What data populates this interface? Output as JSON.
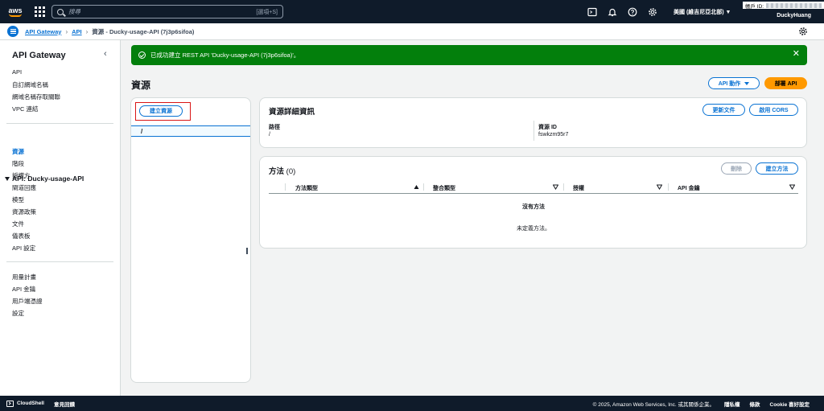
{
  "topnav": {
    "logo": "aws",
    "search_placeholder": "搜尋",
    "search_shortcut": "[選項+S]",
    "region": "美國 (維吉尼亞北部) ▼",
    "account_label": "帳戶 ID:",
    "username": "DuckyHuang"
  },
  "breadcrumbs": {
    "item1": "API Gateway",
    "item2": "API",
    "item3": "資源 - Ducky-usage-API (7j3p6sifoa)"
  },
  "sidebar": {
    "title": "API Gateway",
    "top_items": [
      "API",
      "自訂網域名稱",
      "網域名稱存取關聯",
      "VPC 連結"
    ],
    "api_section": "API: Ducky-usage-API",
    "api_items": [
      "資源",
      "階段",
      "授權方",
      "閘道回應",
      "模型",
      "資源政策",
      "文件",
      "儀表板",
      "API 設定"
    ],
    "bottom_items": [
      "用量計畫",
      "API 金鑰",
      "用戶端憑證",
      "設定"
    ]
  },
  "flash": {
    "message": "已成功建立 REST API 'Ducky-usage-API (7j3p6sifoa)'。"
  },
  "main": {
    "title": "資源",
    "api_actions": "API 動作",
    "deploy": "部署 API",
    "create_resource": "建立資源",
    "root_path": "/"
  },
  "details": {
    "title": "資源詳細資訊",
    "update_docs": "更新文件",
    "enable_cors": "啟用 CORS",
    "path_label": "路徑",
    "path_value": "/",
    "id_label": "資源 ID",
    "id_value": "fswkzm95r7"
  },
  "methods": {
    "title": "方法",
    "count": "(0)",
    "delete": "刪除",
    "create": "建立方法",
    "columns": [
      "方法類型",
      "整合類型",
      "授權",
      "API 金鑰"
    ],
    "empty_title": "沒有方法",
    "empty_desc": "未定義方法。"
  },
  "footer": {
    "cloudshell": "CloudShell",
    "feedback": "意見回饋",
    "copyright": "© 2025, Amazon Web Services, Inc. 或其關係企業。",
    "privacy": "隱私權",
    "terms": "條款",
    "cookie": "Cookie 喜好設定"
  },
  "colors": {
    "nav_bg": "#0f1b2a",
    "link": "#0972d3",
    "success": "#037f0c",
    "primary": "#ff9900"
  }
}
